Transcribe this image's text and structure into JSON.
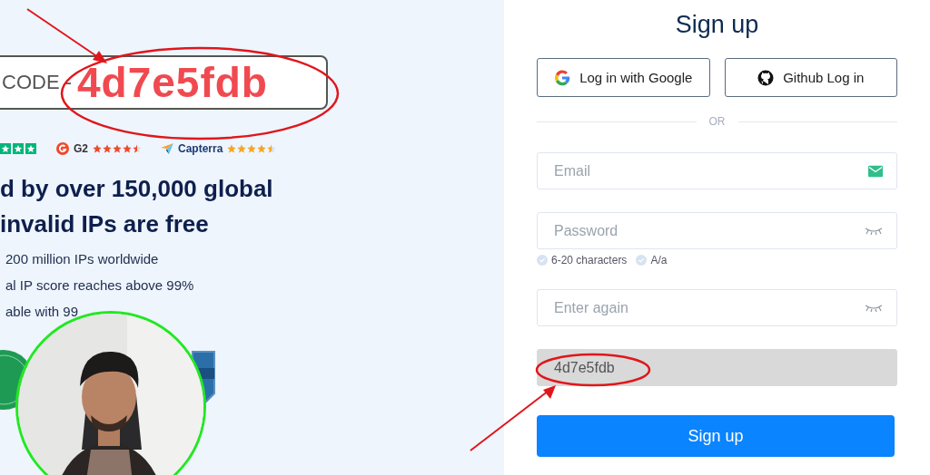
{
  "promo_code": {
    "label": "CODE -",
    "code": "4d7e5fdb"
  },
  "ratings": [
    {
      "kind": "trustpilot"
    },
    {
      "kind": "g2",
      "name": "G2",
      "stars": 4.5
    },
    {
      "kind": "capterra",
      "name": "Capterra",
      "stars": 4.5
    }
  ],
  "headline": [
    "d by over 150,000 global",
    "invalid IPs are free"
  ],
  "bullets": [
    "200 million IPs worldwide",
    "al IP score reaches above 99%",
    "able with 99"
  ],
  "webcam": {
    "kind": "picture"
  },
  "signup": {
    "title": "Sign up",
    "social_buttons": [
      {
        "kind": "google",
        "label": "Log in with Google"
      },
      {
        "kind": "github",
        "label": "Github Log in"
      }
    ],
    "divider": "OR",
    "fields": [
      {
        "kind": "email",
        "placeholder": "Email"
      },
      {
        "kind": "password",
        "placeholder": "Password",
        "hints": [
          "6-20 characters",
          "A/a"
        ]
      },
      {
        "kind": "password",
        "placeholder": "Enter again"
      },
      {
        "kind": "code",
        "value": "4d7e5fdb",
        "disabled": true
      }
    ],
    "submit": "Sign up"
  }
}
